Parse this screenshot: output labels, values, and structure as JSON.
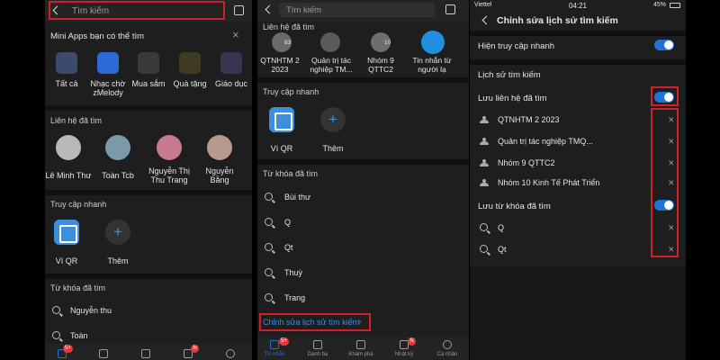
{
  "panel1": {
    "search_placeholder": "Tìm kiếm",
    "mini_apps_title": "Mini Apps bạn có thể tìm",
    "apps": [
      "Tất cả",
      "Nhạc chờ zMelody",
      "Mua sắm",
      "Quà tặng",
      "Giáo dục"
    ],
    "contacts_title": "Liên hệ đã tìm",
    "contacts": [
      "Lê Minh Thư",
      "Toàn Tcb",
      "Nguyễn Thị Thu Trang",
      "Nguyễn Bằng"
    ],
    "quick_title": "Truy cập nhanh",
    "quick_items": [
      "Ví QR",
      "Thêm"
    ],
    "keywords_title": "Từ khóa đã tìm",
    "keywords": [
      "Nguyễn thu",
      "Toàn"
    ],
    "nav_badge_1": "5+",
    "nav_badge_4": "N"
  },
  "panel2": {
    "search_placeholder": "Tìm kiếm",
    "contacts_title": "Liên hệ đã tìm",
    "contacts": [
      "QTNHTM 2 2023",
      "Quản trị tác nghiệp TM...",
      "Nhóm 9 QTTC2",
      "Tin nhắn từ người lạ"
    ],
    "contact_counts": [
      "83",
      "",
      "10",
      ""
    ],
    "quick_title": "Truy cập nhanh",
    "quick_items": [
      "Ví QR",
      "Thêm"
    ],
    "keywords_title": "Từ khóa đã tìm",
    "keywords": [
      "Bùi thư",
      "Q",
      "Qt",
      "Thuỳ",
      "Trang"
    ],
    "edit_history_link": "Chỉnh sửa lịch sử tìm kiếm",
    "nav_labels": [
      "Tin nhắn",
      "Danh bạ",
      "Khám phá",
      "Nhật ký",
      "Cá nhân"
    ],
    "nav_badge_1": "5+",
    "nav_badge_4": "N"
  },
  "panel3": {
    "status": {
      "carrier": "Viettel",
      "time": "04:21",
      "battery": "45%"
    },
    "title": "Chỉnh sửa lịch sử tìm kiếm",
    "show_quick_access": "Hiện truy cập nhanh",
    "history_title": "Lịch sử tìm kiếm",
    "save_contacts": "Lưu liên hệ đã tìm",
    "contacts": [
      "QTNHTM 2 2023",
      "Quản trị tác nghiệp TMQ...",
      "Nhóm 9 QTTC2",
      "Nhóm 10 Kinh Tế Phát Triển"
    ],
    "save_keywords": "Lưu từ khóa đã tìm",
    "keywords": [
      "Q",
      "Qt"
    ],
    "toggle_show_quick": true,
    "toggle_save_contacts": true,
    "toggle_save_keywords": true
  },
  "colors": {
    "accent": "#1f73d8",
    "highlight_box": "#d21f2b",
    "background": "#1e1e1e"
  }
}
